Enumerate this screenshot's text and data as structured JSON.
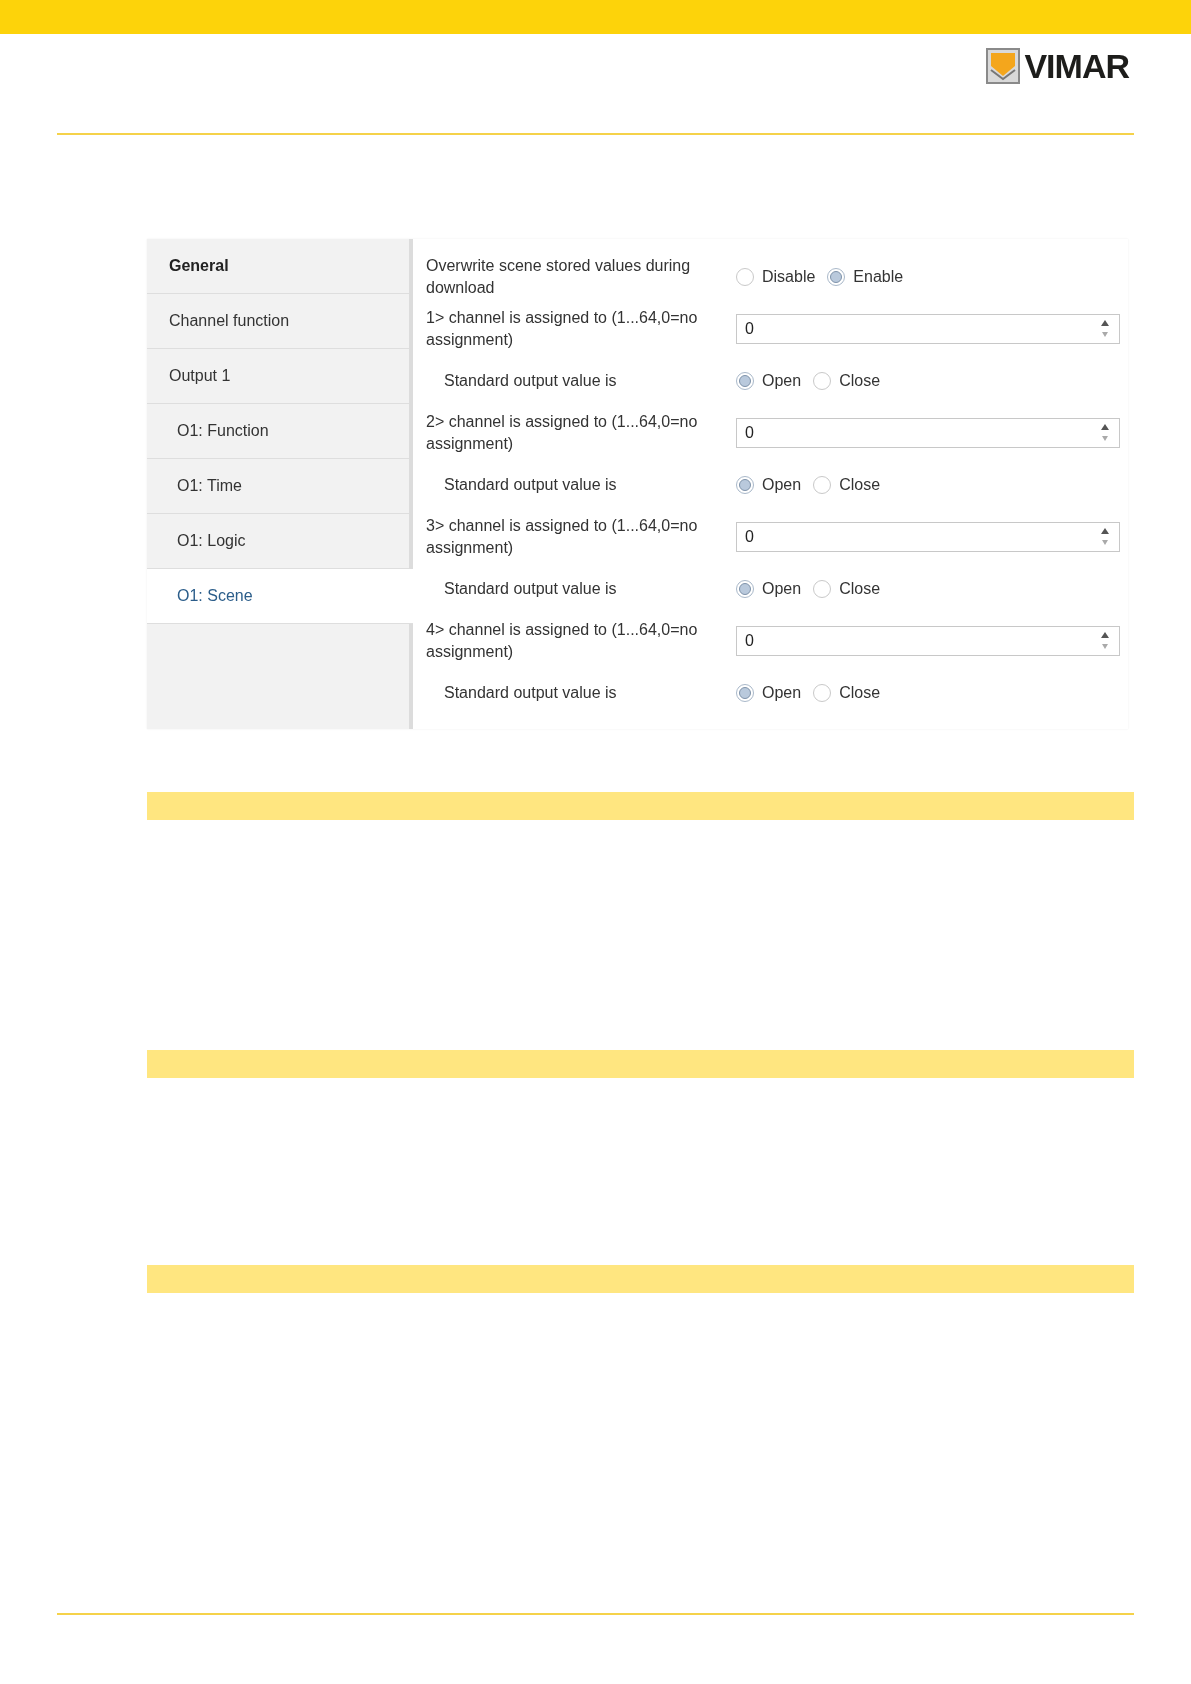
{
  "brand": {
    "name": "VIMAR"
  },
  "sidebar": {
    "items": [
      {
        "label": "General",
        "kind": "header",
        "selected": false
      },
      {
        "label": "Channel function",
        "kind": "page",
        "selected": false
      },
      {
        "label": "Output 1",
        "kind": "page",
        "selected": false,
        "children": [
          {
            "label": "O1: Function",
            "kind": "page",
            "selected": false
          },
          {
            "label": "O1: Time",
            "kind": "page",
            "selected": false
          },
          {
            "label": "O1: Logic",
            "kind": "page",
            "selected": false
          },
          {
            "label": "O1: Scene",
            "kind": "page",
            "selected": true
          }
        ]
      }
    ]
  },
  "settings": [
    {
      "kind": "radio",
      "label": "Overwrite scene stored values during download",
      "indented": false,
      "options": [
        {
          "label": "Disable",
          "selected": false
        },
        {
          "label": "Enable",
          "selected": true
        }
      ]
    },
    {
      "kind": "number",
      "label": "1> channel is assigned to (1...64,0=no assignment)",
      "value": "0"
    },
    {
      "kind": "radio",
      "label": "Standard output value is",
      "indented": true,
      "options": [
        {
          "label": "Open",
          "selected": true
        },
        {
          "label": "Close",
          "selected": false
        }
      ]
    },
    {
      "kind": "number",
      "label": "2> channel is assigned to (1...64,0=no assignment)",
      "value": "0"
    },
    {
      "kind": "radio",
      "label": "Standard output value is",
      "indented": true,
      "options": [
        {
          "label": "Open",
          "selected": true
        },
        {
          "label": "Close",
          "selected": false
        }
      ]
    },
    {
      "kind": "number",
      "label": "3> channel is assigned to (1...64,0=no assignment)",
      "value": "0"
    },
    {
      "kind": "radio",
      "label": "Standard output value is",
      "indented": true,
      "options": [
        {
          "label": "Open",
          "selected": true
        },
        {
          "label": "Close",
          "selected": false
        }
      ]
    },
    {
      "kind": "number",
      "label": "4> channel is assigned to (1...64,0=no assignment)",
      "value": "0"
    },
    {
      "kind": "radio",
      "label": "Standard output value is",
      "indented": true,
      "options": [
        {
          "label": "Open",
          "selected": true
        },
        {
          "label": "Close",
          "selected": false
        }
      ]
    }
  ]
}
